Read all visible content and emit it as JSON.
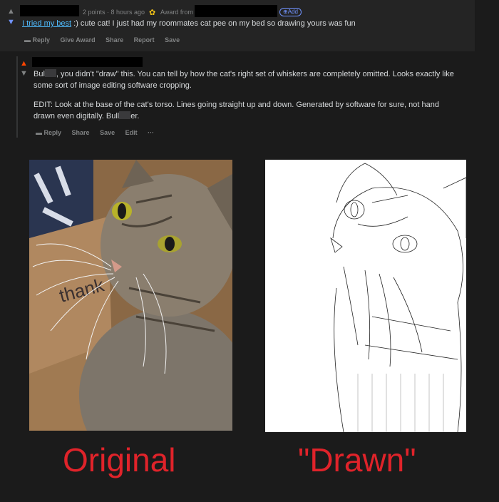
{
  "comment1": {
    "meta": "2 points · 8 hours ago",
    "award_label": "Award from",
    "add_label": "⊕Add",
    "flair": "I tried my best",
    "text": ":) cute cat! I just had my roommates cat pee on my bed so drawing yours was fun",
    "actions": [
      "Reply",
      "Give Award",
      "Share",
      "Report",
      "Save"
    ]
  },
  "comment2": {
    "para1_start": "Bul",
    "para1_rest": ", you didn't \"draw\" this. You can tell by how the cat's right set of whiskers are completely omitted. Looks exactly like some sort of image editing software cropping.",
    "para2_start": "EDIT: Look at the base of the cat's torso. Lines going straight up and down. Generated by software for sure, not hand drawn even digitally. Bull",
    "para2_end": "er.",
    "actions": [
      "Reply",
      "Share",
      "Save",
      "Edit",
      "···"
    ]
  },
  "images": {
    "left_label": "Original",
    "right_label": "\"Drawn\"",
    "box_text": "thank"
  },
  "colors": {
    "label_red": "#e0232a",
    "upvote_orange": "#ff4500",
    "downvote_blue": "#7193ff",
    "flair_blue": "#4fbcff"
  }
}
